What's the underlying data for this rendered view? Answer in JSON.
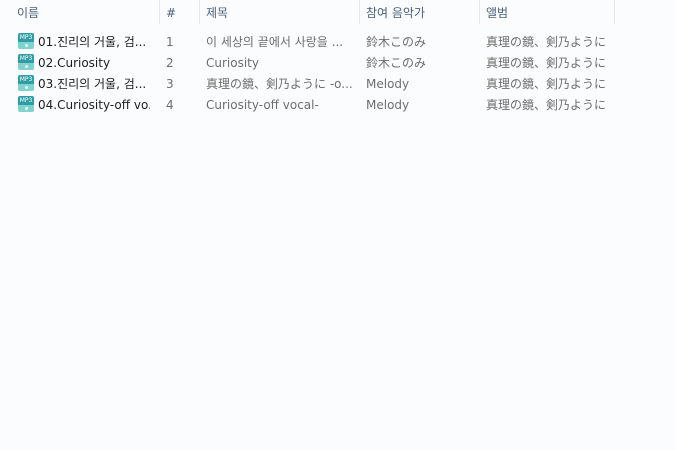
{
  "columns": {
    "name": "이름",
    "number": "#",
    "title": "제목",
    "artist": "참여 음악가",
    "album": "앨범"
  },
  "sort_indicator": "^",
  "files": [
    {
      "icon": "mp3-file-icon",
      "icon_badge": "MP3",
      "name": "01.진리의 거울, 검...",
      "number": "1",
      "title": "이 세상의 끝에서 사랑을 ...",
      "artist": "鈴木このみ",
      "album": "真理の鏡、剣乃ように"
    },
    {
      "icon": "mp3-file-icon",
      "icon_badge": "MP3",
      "name": "02.Curiosity",
      "number": "2",
      "title": "Curiosity",
      "artist": "鈴木このみ",
      "album": "真理の鏡、剣乃ように"
    },
    {
      "icon": "mp3-file-icon",
      "icon_badge": "MP3",
      "name": "03.진리의 거울, 검...",
      "number": "3",
      "title": "真理の鏡、剣乃ように -o...",
      "artist": "Melody",
      "album": "真理の鏡、剣乃ように"
    },
    {
      "icon": "mp3-file-icon",
      "icon_badge": "MP3",
      "name": "04.Curiosity-off vo...",
      "number": "4",
      "title": "Curiosity-off vocal-",
      "artist": "Melody",
      "album": "真理の鏡、剣乃ように"
    }
  ]
}
